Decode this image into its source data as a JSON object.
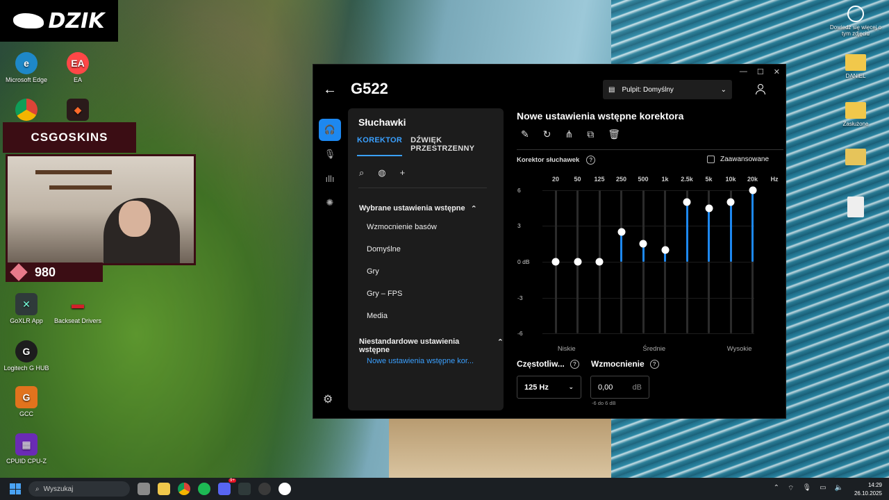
{
  "overlay": {
    "brand_logo": "DZIK",
    "sponsor_banner": "CSGOSKINS",
    "counter_value": "980"
  },
  "desktop_icons_left": [
    {
      "label": "Microsoft Edge",
      "color": "#1e88c8"
    },
    {
      "label": "EA",
      "color": "#ff4747"
    },
    {
      "label": "GoXLR App",
      "color": "#2f3a3a"
    },
    {
      "label": "Backseat Drivers",
      "color": "#d2202a"
    },
    {
      "label": "Logitech G HUB",
      "color": "#1d1d1d"
    },
    {
      "label": "GCC",
      "color": "#e1731d"
    },
    {
      "label": "CPUID CPU-Z",
      "color": "#6a2bb4"
    }
  ],
  "desktop_icons_right": [
    {
      "label": "Dowiedz się więcej o tym zdjęciu"
    },
    {
      "label": "DANIEL"
    },
    {
      "label": "Zasłużone"
    },
    {
      "label": ""
    },
    {
      "label": ""
    }
  ],
  "window": {
    "device": "G522",
    "profile_label": "Pulpit: Domyślny",
    "controls": {
      "minimize": "—",
      "maximize": "☐",
      "close": "✕"
    }
  },
  "panel": {
    "title": "Słuchawki",
    "tabs": [
      {
        "label": "KOREKTOR",
        "active": true
      },
      {
        "label": "DŹWIĘK PRZESTRZENNY",
        "active": false
      }
    ],
    "section_featured": "Wybrane ustawienia wstępne",
    "featured_presets": [
      "Wzmocnienie basów",
      "Domyślne",
      "Gry",
      "Gry – FPS",
      "Media"
    ],
    "section_custom": "Niestandardowe ustawienia wstępne",
    "custom_presets": [
      "Nowe ustawienia wstępne kor..."
    ]
  },
  "eq": {
    "title": "Nowe ustawienia wstępne korektora",
    "section_label": "Korektor słuchawek",
    "advanced_label": "Zaawansowane",
    "advanced_checked": false,
    "unit_label": "Hz",
    "db_labels": [
      "6",
      "3",
      "0 dB",
      "-3",
      "-6"
    ],
    "db_range": [
      -6,
      6
    ],
    "bands": [
      {
        "freq": "20",
        "gain": 0
      },
      {
        "freq": "50",
        "gain": 0
      },
      {
        "freq": "125",
        "gain": 0
      },
      {
        "freq": "250",
        "gain": 2.5
      },
      {
        "freq": "500",
        "gain": 1.5
      },
      {
        "freq": "1k",
        "gain": 1
      },
      {
        "freq": "2.5k",
        "gain": 5
      },
      {
        "freq": "5k",
        "gain": 4.5
      },
      {
        "freq": "10k",
        "gain": 5
      },
      {
        "freq": "20k",
        "gain": 6
      }
    ],
    "band_groups": [
      "Niskie",
      "Średnie",
      "Wysokie"
    ],
    "frequency_label": "Częstotliw...",
    "gain_label": "Wzmocnienie",
    "selected_frequency": "125 Hz",
    "gain_value": "0,00",
    "gain_unit": "dB",
    "gain_hint": "-6 do 6 dB",
    "accent_color": "#1d88f0"
  },
  "taskbar": {
    "search_placeholder": "Wyszukaj",
    "time": "14:29",
    "date": "26.10.2025",
    "discord_badge": "9+"
  }
}
